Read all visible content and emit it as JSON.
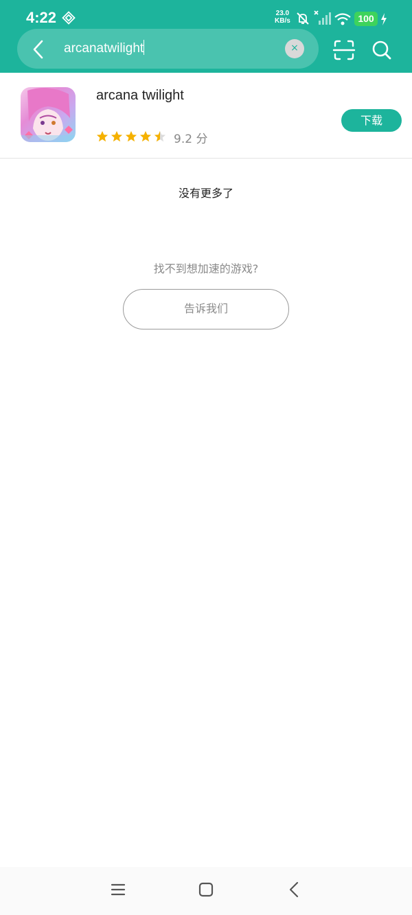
{
  "status_bar": {
    "time": "4:22",
    "net_speed_value": "23.0",
    "net_speed_unit": "KB/s",
    "battery": "100"
  },
  "search": {
    "query": "arcanatwilight",
    "clear_label": "×"
  },
  "result": {
    "app_name": "arcana twilight",
    "rating_text": "9.2 分",
    "rating_value": 9.2,
    "stars": 4.5,
    "download_label": "下载"
  },
  "footer": {
    "no_more": "没有更多了",
    "hint": "找不到想加速的游戏?",
    "tell_us": "告诉我们"
  },
  "colors": {
    "accent": "#1db49c",
    "star": "#f5b100",
    "battery": "#3ed35c"
  }
}
